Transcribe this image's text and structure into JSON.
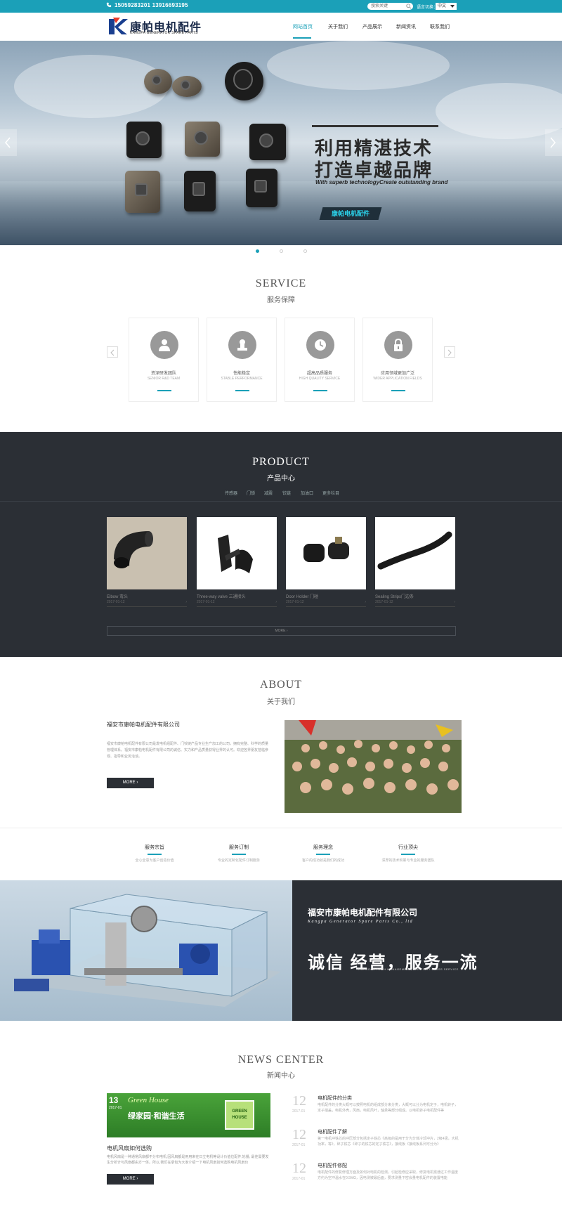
{
  "topbar": {
    "phone": "15059283201 13916693195",
    "search_placeholder": "搜索关键",
    "lang_label": "语言切换：",
    "lang_value": "中文"
  },
  "logo": {
    "cn": "康帕电机配件",
    "en": "KANGPA GENERATOR SPARE PARTS"
  },
  "nav": {
    "items": [
      "网站首页",
      "关于我们",
      "产品展示",
      "新闻资讯",
      "联系我们"
    ],
    "active_index": 0
  },
  "banner": {
    "slogan_line1": "利用精湛技术",
    "slogan_line2": "打造卓越品牌",
    "slogan_en": "With superb technologyCreate outstanding brand",
    "tag": "康帕电机配件"
  },
  "service": {
    "title": "SERVICE",
    "subtitle": "服务保障",
    "cards": [
      {
        "cn": "资深研发团队",
        "en": "SENIOR R&D TEAM",
        "icon": "person-icon"
      },
      {
        "cn": "性能稳定",
        "en": "STABLE PERFORMANCE",
        "icon": "stamp-icon"
      },
      {
        "cn": "超高品质服务",
        "en": "HIGH QUALITY SERVICE",
        "icon": "clock-icon"
      },
      {
        "cn": "应用领域更加广泛",
        "en": "WIDER APPLICATION FIELDS",
        "icon": "lock-icon"
      }
    ]
  },
  "product": {
    "title": "PRODUCT",
    "subtitle": "产品中心",
    "categories": [
      "传感器",
      "门锁",
      "减震",
      "铰链",
      "加油口",
      "更多栏目"
    ],
    "items": [
      {
        "name": "Elbow 弯头",
        "date": "2017-01-12"
      },
      {
        "name": "Three-way valve 三通接头",
        "date": "2017-01-12"
      },
      {
        "name": "Door Holder 门碰",
        "date": "2017-01-12"
      },
      {
        "name": "Sealing Strips门边条",
        "date": "2017-01-12"
      }
    ],
    "more": "MORE ›"
  },
  "about": {
    "title": "ABOUT",
    "subtitle": "关于我们",
    "company": "福安市康帕电机配件有限公司",
    "desc": "福安市康帕电机配件有限公司是发电机组配件、门铰链产品专业生产加工的公司，拥有完整、科学的质量管理体系。福安市康帕电机配件有限公司的诚信、实力和产品质量获得业界的认可。欢迎各界朋友莅临参观、指导和业务洽谈。",
    "more": "MORE  ›"
  },
  "values": [
    {
      "title": "服务宗旨",
      "desc": "全心全意为客户创造价值"
    },
    {
      "title": "服务订制",
      "desc": "专业的定制化配件订制服务"
    },
    {
      "title": "服务理念",
      "desc": "客户的成功就是我们的成功"
    },
    {
      "title": "行业顶尖",
      "desc": "深厚的技术积累与专业的服务团队"
    }
  ],
  "promo": {
    "company": "福安市康帕电机配件有限公司",
    "company_en": "Kangpa Generator Spare Parts Co., ltd",
    "motto": "诚信 经营，服务一流",
    "motto_en": "THE GOOD FAITH MANAGEMENT, THE FIRST-CLASS SERVICE"
  },
  "news": {
    "title": "NEWS CENTER",
    "subtitle": "新闻中心",
    "feature": {
      "image_text_day": "13",
      "image_text_ym": "2017-01",
      "image_text_brand": "Green House",
      "image_text_cn": "绿家园·和谐生活",
      "image_badge": "GREEN HOUSE",
      "title": "电机风扇如何选购",
      "desc": "电机风扇是一种通常风扇都不分布电机,因风扇都是用用来在日立电机等设计价值位配件,轮播, 最佳需要发生分析计与风扇都由方一体。所以,我们在承包为大家介绍一下电机风扇如何选购电机风扇价",
      "more": "MORE  ›"
    },
    "items": [
      {
        "day": "12",
        "ym": "2017-01",
        "title": "电机配件的分类",
        "desc": "电机配件的分类大概可以按照电机的组成部分来分类，大概可以分为电机定子，电机转子，定子端盖，电机外壳，风扇，电机风叶，轴承等部分组成。以电机转子电机配件等"
      },
      {
        "day": "12",
        "ym": "2017-01",
        "title": "电机配件了解",
        "desc": "第一电机冲铁芯的冲压部分包括定子铁芯《高级的是用于分为分体冷却冲片，2级4极，大机功率，等》，碎子铁芯《碎子的铁芯的定子铁芯》，接线板《接线板系列可分为》"
      },
      {
        "day": "12",
        "ym": "2017-01",
        "title": "电机配件修配",
        "desc": "电机配件的修复修理方面及如何对电机的检测，引起检修应采取，修复电机需通过工作温度方约为空冲温水在0.5MΩ，因电测被最后面，要求测量下密会量电机配件的装置电能"
      }
    ]
  }
}
